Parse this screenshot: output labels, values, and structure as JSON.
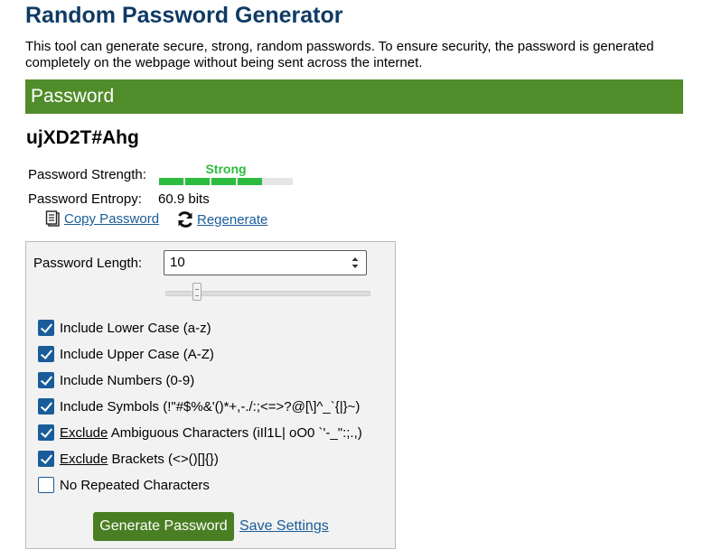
{
  "page": {
    "title": "Random Password Generator",
    "intro": "This tool can generate secure, strong, random passwords. To ensure security, the password is generated completely on the webpage without being sent across the internet."
  },
  "password_section": {
    "header": "Password",
    "value": "ujXD2T#Ahg",
    "strength_label": "Password Strength:",
    "strength_text": "Strong",
    "strength_level_fraction": 0.8,
    "entropy_label": "Password Entropy:",
    "entropy_value": "60.9 bits",
    "copy_label": "Copy Password",
    "regenerate_label": "Regenerate",
    "copy_icon": "clipboard-icon",
    "regenerate_icon": "refresh-icon"
  },
  "settings": {
    "length_label": "Password Length:",
    "length_value": "10",
    "options": [
      {
        "pre": "",
        "underlined": "",
        "label": "Include Lower Case (a-z)",
        "checked": true
      },
      {
        "pre": "",
        "underlined": "",
        "label": "Include Upper Case (A-Z)",
        "checked": true
      },
      {
        "pre": "",
        "underlined": "",
        "label": "Include Numbers (0-9)",
        "checked": true
      },
      {
        "pre": "",
        "underlined": "",
        "label": "Include Symbols (!\"#$%&'()*+,-./:;<=>?@[\\]^_`{|}~)",
        "checked": true
      },
      {
        "pre": "",
        "underlined": "Exclude",
        "label": " Ambiguous Characters (iIl1L| oO0 `'-_\":;.,)",
        "checked": true
      },
      {
        "pre": "",
        "underlined": "Exclude",
        "label": " Brackets (<>()[]{})",
        "checked": true
      },
      {
        "pre": "",
        "underlined": "",
        "label": "No Repeated Characters",
        "checked": false
      }
    ],
    "generate_label": "Generate Password",
    "save_label": "Save Settings"
  },
  "colors": {
    "title": "#0f3a64",
    "header_bg": "#518c2a",
    "strength": "#2dbb3f",
    "link": "#1a5c9a",
    "checkbox": "#1a5c9a",
    "button_bg": "#4a7e23"
  }
}
